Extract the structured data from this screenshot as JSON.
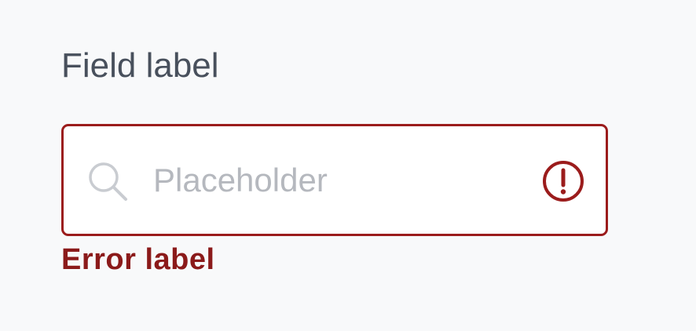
{
  "field": {
    "label": "Field label",
    "placeholder": "Placeholder",
    "value": "",
    "error_label": "Error label",
    "leading_icon": "search-icon",
    "trailing_icon": "error-circle-icon"
  },
  "colors": {
    "background": "#f8f9fa",
    "label": "#48505c",
    "error": "#9b1c1c",
    "placeholder": "#b5b8be",
    "icon_muted": "#c9ccd1"
  }
}
